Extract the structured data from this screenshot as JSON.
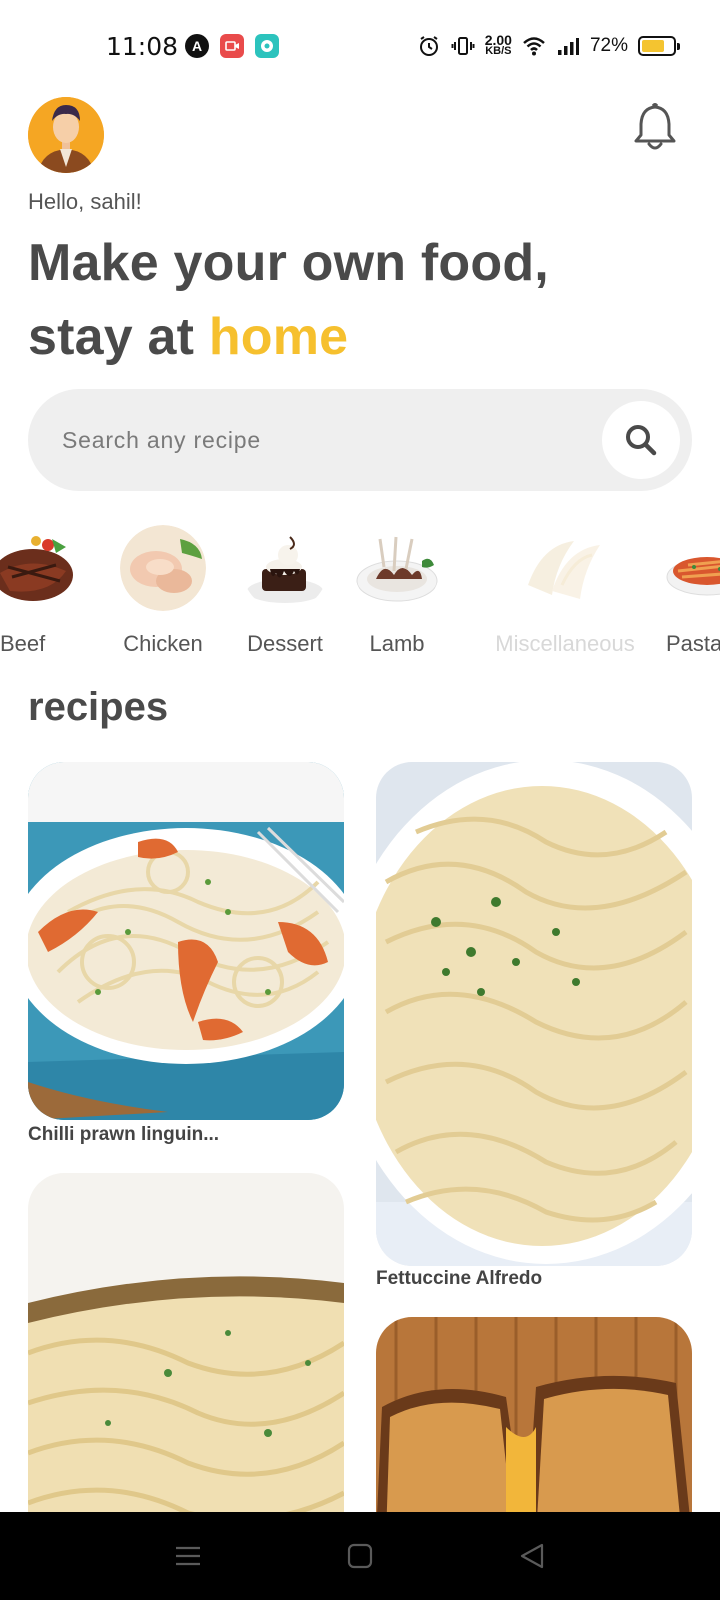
{
  "status_bar": {
    "time": "11:08",
    "net_speed_value": "2.00",
    "net_speed_unit": "KB/S",
    "battery_pct": "72%",
    "battery_level": 0.72,
    "battery_color": "#f4c430"
  },
  "header": {
    "avatar_icon": "user-avatar-icon",
    "notification_icon": "bell-icon",
    "greeting": "Hello, sahil!",
    "headline_line1": "Make your own food,",
    "headline_line2_prefix": "stay at ",
    "headline_line2_accent": "home",
    "accent_color": "#f6c02e"
  },
  "search": {
    "placeholder": "Search any recipe",
    "icon": "search-icon"
  },
  "categories": [
    {
      "label": "Beef"
    },
    {
      "label": "Chicken"
    },
    {
      "label": "Dessert"
    },
    {
      "label": "Lamb"
    },
    {
      "label": "Miscellaneous"
    },
    {
      "label": "Pasta"
    }
  ],
  "recipes_section": {
    "title": "recipes",
    "items": [
      {
        "title": "Chilli prawn linguin..."
      },
      {
        "title": "Fettuccine Alfredo"
      },
      {
        "title": ""
      },
      {
        "title": ""
      }
    ]
  },
  "nav_bar": {
    "icons": [
      "menu-icon",
      "home-square-icon",
      "back-triangle-icon"
    ]
  }
}
